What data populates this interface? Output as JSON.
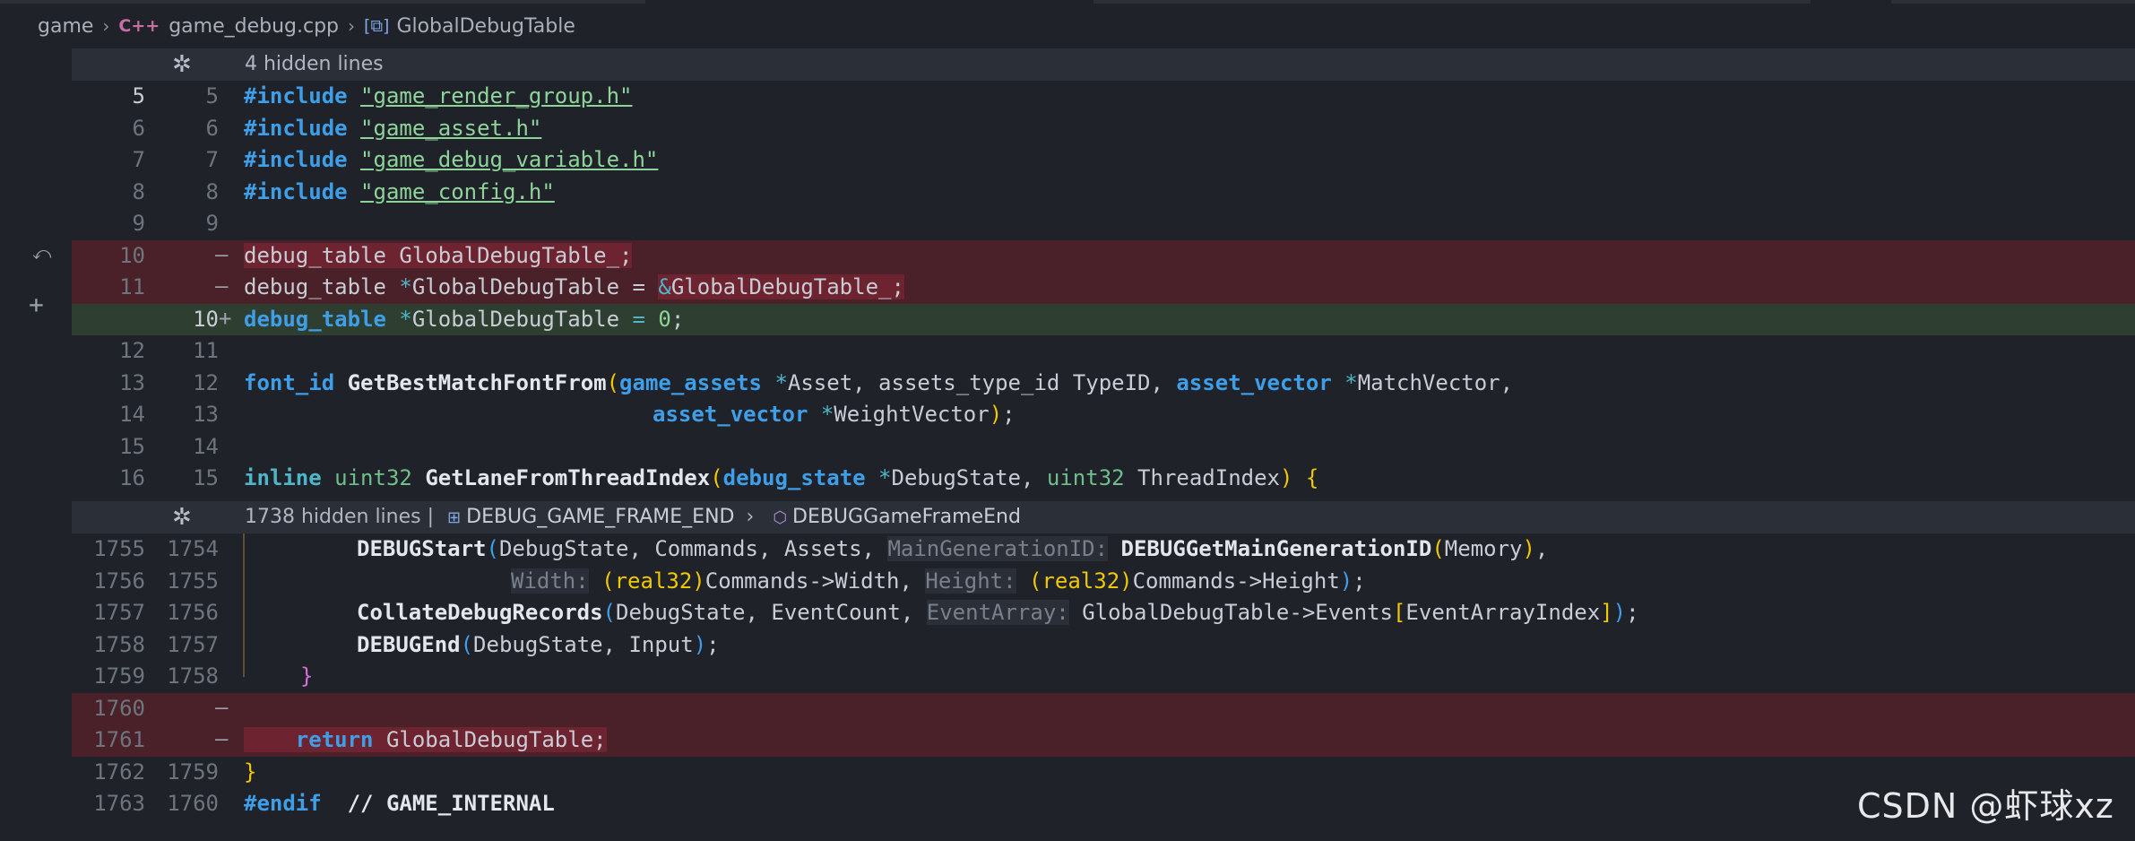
{
  "breadcrumb": {
    "folder": "game",
    "file_icon": "C++",
    "file": "game_debug.cpp",
    "symbol_icon": "class-icon",
    "symbol": "GlobalDebugTable"
  },
  "folds": [
    {
      "label": "4 hidden lines",
      "crumb1": "",
      "crumb2": ""
    },
    {
      "label": "1738 hidden lines",
      "sep": "|",
      "crumb1": "DEBUG_GAME_FRAME_END",
      "crumb2": "DEBUGGameFrameEnd"
    }
  ],
  "rows": [
    {
      "old": "5",
      "new": "5",
      "mark": "",
      "type": "ctx"
    },
    {
      "old": "6",
      "new": "6",
      "mark": "",
      "type": "ctx"
    },
    {
      "old": "7",
      "new": "7",
      "mark": "",
      "type": "ctx"
    },
    {
      "old": "8",
      "new": "8",
      "mark": "",
      "type": "ctx"
    },
    {
      "old": "9",
      "new": "9",
      "mark": "",
      "type": "ctx"
    },
    {
      "old": "10",
      "new": "",
      "mark": "—",
      "type": "del"
    },
    {
      "old": "11",
      "new": "",
      "mark": "—",
      "type": "del"
    },
    {
      "old": "",
      "new": "10",
      "mark": "+",
      "type": "add"
    },
    {
      "old": "12",
      "new": "11",
      "mark": "",
      "type": "ctx"
    },
    {
      "old": "13",
      "new": "12",
      "mark": "",
      "type": "ctx"
    },
    {
      "old": "14",
      "new": "13",
      "mark": "",
      "type": "ctx"
    },
    {
      "old": "15",
      "new": "14",
      "mark": "",
      "type": "ctx"
    },
    {
      "old": "16",
      "new": "15",
      "mark": "",
      "type": "ctx"
    },
    {
      "old": "1755",
      "new": "1754",
      "mark": "",
      "type": "ctx"
    },
    {
      "old": "1756",
      "new": "1755",
      "mark": "",
      "type": "ctx"
    },
    {
      "old": "1757",
      "new": "1756",
      "mark": "",
      "type": "ctx"
    },
    {
      "old": "1758",
      "new": "1757",
      "mark": "",
      "type": "ctx"
    },
    {
      "old": "1759",
      "new": "1758",
      "mark": "",
      "type": "ctx"
    },
    {
      "old": "1760",
      "new": "",
      "mark": "—",
      "type": "del"
    },
    {
      "old": "1761",
      "new": "",
      "mark": "—",
      "type": "del"
    },
    {
      "old": "1762",
      "new": "1759",
      "mark": "",
      "type": "ctx"
    },
    {
      "old": "1763",
      "new": "1760",
      "mark": "",
      "type": "ctx"
    }
  ],
  "code": {
    "l5_pp": "#include",
    "l5_str": "\"game_render_group.h\"",
    "l6_pp": "#include",
    "l6_str": "\"game_asset.h\"",
    "l7_pp": "#include",
    "l7_str": "\"game_debug_variable.h\"",
    "l8_pp": "#include",
    "l8_str": "\"game_config.h\"",
    "l10": "debug_table GlobalDebugTable_;",
    "l11_a": "debug_table ",
    "l11_b": "*",
    "l11_c": "GlobalDebugTable = ",
    "l11_d": "&",
    "l11_e": "GlobalDebugTable_;",
    "n10_ty": "debug_table",
    "n10_ptr": " *",
    "n10_name": "GlobalDebugTable",
    "n10_eq": " = ",
    "n10_num": "0",
    "n10_end": ";",
    "f12_ty": "font_id",
    "f12_fn": "GetBestMatchFontFrom",
    "f12_p": "(",
    "f12_t1": "game_assets",
    "f12_s1": " *",
    "f12_a1": "Asset, assets_type_id TypeID, ",
    "f12_t2": "asset_vector",
    "f12_s2": " *",
    "f12_a2": "MatchVector,",
    "f13_t": "asset_vector",
    "f13_s": " *",
    "f13_a": "WeightVector",
    "f13_p": ")",
    "f13_e": ";",
    "f15_kw": "inline",
    "f15_ty": "uint32",
    "f15_fn": "GetLaneFromThreadIndex",
    "f15_p": "(",
    "f15_t1": "debug_state",
    "f15_s1": " *",
    "f15_a1": "DebugState, ",
    "f15_t2": "uint32",
    "f15_a2": " ThreadIndex",
    "f15_p2": ")",
    "f15_b": " {",
    "g1754_fn": "DEBUGStart",
    "g1754_p": "(",
    "g1754_a": "DebugState, Commands, Assets, ",
    "g1754_h": "MainGenerationID:",
    "g1754_fn2": "DEBUGGetMainGenerationID",
    "g1754_p2": "(",
    "g1754_m": "Memory",
    "g1754_p3": ")",
    "g1754_e": ",",
    "g1755_h1": "Width:",
    "g1755_c1": "(real32)",
    "g1755_a1": "Commands->Width, ",
    "g1755_h2": "Height:",
    "g1755_c2": "(real32)",
    "g1755_a2": "Commands->Height",
    "g1755_p": ")",
    "g1755_e": ";",
    "g1756_fn": "CollateDebugRecords",
    "g1756_p": "(",
    "g1756_a": "DebugState, EventCount, ",
    "g1756_h": "EventArray:",
    "g1756_b": "GlobalDebugTable->Events",
    "g1756_br": "[",
    "g1756_i": "EventArrayIndex",
    "g1756_br2": "]",
    "g1756_p2": ")",
    "g1756_e": ";",
    "g1757_fn": "DEBUGEnd",
    "g1757_p": "(",
    "g1757_a": "DebugState, Input",
    "g1757_p2": ")",
    "g1757_e": ";",
    "g1758": "}",
    "g1761_kw": "return",
    "g1761_a": " GlobalDebugTable;",
    "g1762": "}",
    "g1763_pp": "#endif",
    "g1763_c": "  // GAME_INTERNAL"
  },
  "watermark": "CSDN @虾球xz"
}
